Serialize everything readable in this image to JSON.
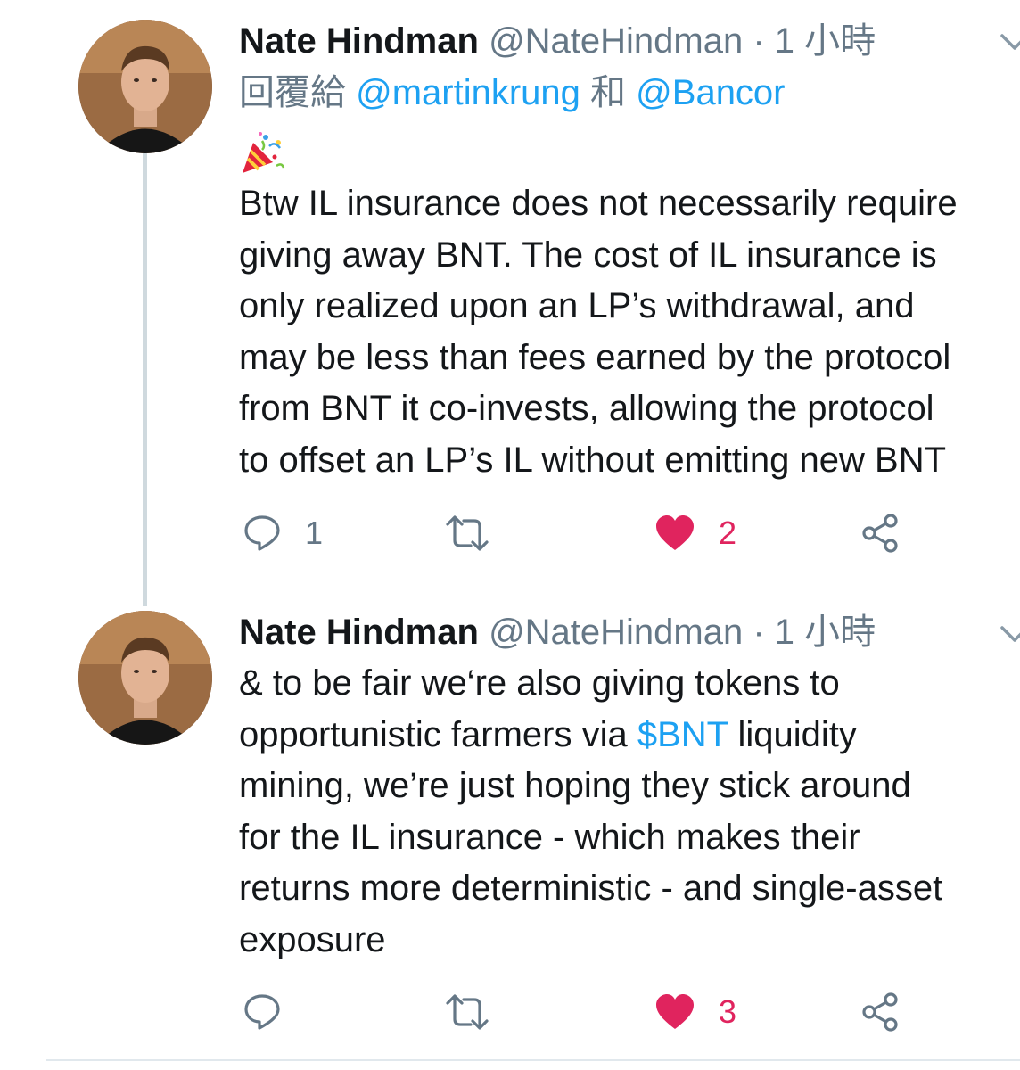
{
  "tweets": [
    {
      "author_name": "Nate Hindman",
      "handle": "@NateHindman",
      "separator": " · ",
      "time": "1 小時",
      "reply_prefix": "回覆給 ",
      "reply_mention_1": "@martinkrung",
      "reply_conj": " 和 ",
      "reply_mention_2": "@Bancor",
      "emoji": "party-popper",
      "text_lines": [
        "Btw IL insurance does not necessarily require",
        "giving away BNT. The cost of IL insurance is",
        "only realized upon an LP’s withdrawal, and",
        "may be less than fees earned by the protocol",
        "from BNT it co-invests, allowing the protocol",
        "to offset an LP’s IL without emitting new BNT"
      ],
      "reply_count": "1",
      "retweet_count": "",
      "like_count": "2",
      "liked": true
    },
    {
      "author_name": "Nate Hindman",
      "handle": "@NateHindman",
      "separator": " · ",
      "time": "1 小時",
      "text_line_1": "& to be fair we‘re also giving tokens to",
      "text_line_2_before": "opportunistic farmers via ",
      "text_line_2_cashtag": "$BNT",
      "text_line_2_after": " liquidity",
      "text_lines_rest": [
        "mining, we’re just hoping they stick around",
        "for the IL insurance - which makes their",
        "returns more deterministic - and single-asset",
        "exposure"
      ],
      "reply_count": "",
      "retweet_count": "",
      "like_count": "3",
      "liked": true
    }
  ],
  "colors": {
    "link": "#1da1f2",
    "like": "#e0245e",
    "muted": "#657786",
    "text": "#14171a"
  }
}
